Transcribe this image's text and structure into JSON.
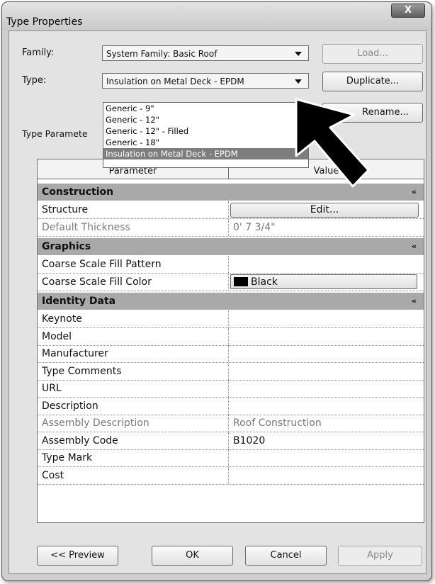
{
  "window": {
    "title": "Type Properties",
    "close_glyph": "X"
  },
  "family": {
    "label": "Family:",
    "value": "System Family: Basic Roof",
    "load_label": "Load..."
  },
  "type": {
    "label": "Type:",
    "value": "Insulation on Metal Deck - EPDM",
    "duplicate_label": "Duplicate...",
    "rename_label": "Rename...",
    "options": [
      "Generic - 9\"",
      "Generic - 12\"",
      "Generic - 12\" - Filled",
      "Generic - 18\"",
      "Insulation on Metal Deck - EPDM"
    ],
    "selected_option": "Insulation on Metal Deck - EPDM"
  },
  "type_parameters_label": "Type Paramete",
  "grid": {
    "header_parameter": "Parameter",
    "header_value": "Value",
    "groups": [
      {
        "name": "Construction",
        "rows": [
          {
            "param": "Structure",
            "value": "Edit...",
            "kind": "button"
          },
          {
            "param": "Default Thickness",
            "value": "0'  7 3/4\"",
            "kind": "readonly"
          }
        ]
      },
      {
        "name": "Graphics",
        "rows": [
          {
            "param": "Coarse Scale Fill Pattern",
            "value": "",
            "kind": "text"
          },
          {
            "param": "Coarse Scale Fill Color",
            "value": "Black",
            "kind": "color",
            "color": "#000000"
          }
        ]
      },
      {
        "name": "Identity Data",
        "rows": [
          {
            "param": "Keynote",
            "value": "",
            "kind": "text"
          },
          {
            "param": "Model",
            "value": "",
            "kind": "text"
          },
          {
            "param": "Manufacturer",
            "value": "",
            "kind": "text"
          },
          {
            "param": "Type Comments",
            "value": "",
            "kind": "text"
          },
          {
            "param": "URL",
            "value": "",
            "kind": "text"
          },
          {
            "param": "Description",
            "value": "",
            "kind": "text"
          },
          {
            "param": "Assembly Description",
            "value": "Roof Construction",
            "kind": "readonly"
          },
          {
            "param": "Assembly Code",
            "value": "B1020",
            "kind": "text"
          },
          {
            "param": "Type Mark",
            "value": "",
            "kind": "text"
          },
          {
            "param": "Cost",
            "value": "",
            "kind": "text"
          }
        ]
      }
    ],
    "collapse_glyph": "«"
  },
  "buttons": {
    "preview": "<< Preview",
    "ok": "OK",
    "cancel": "Cancel",
    "apply": "Apply"
  },
  "icons": {
    "close": "close-icon",
    "dropdown": "chevron-down-icon",
    "collapse": "collapse-icon",
    "pointer": "arrow-pointer-icon"
  }
}
